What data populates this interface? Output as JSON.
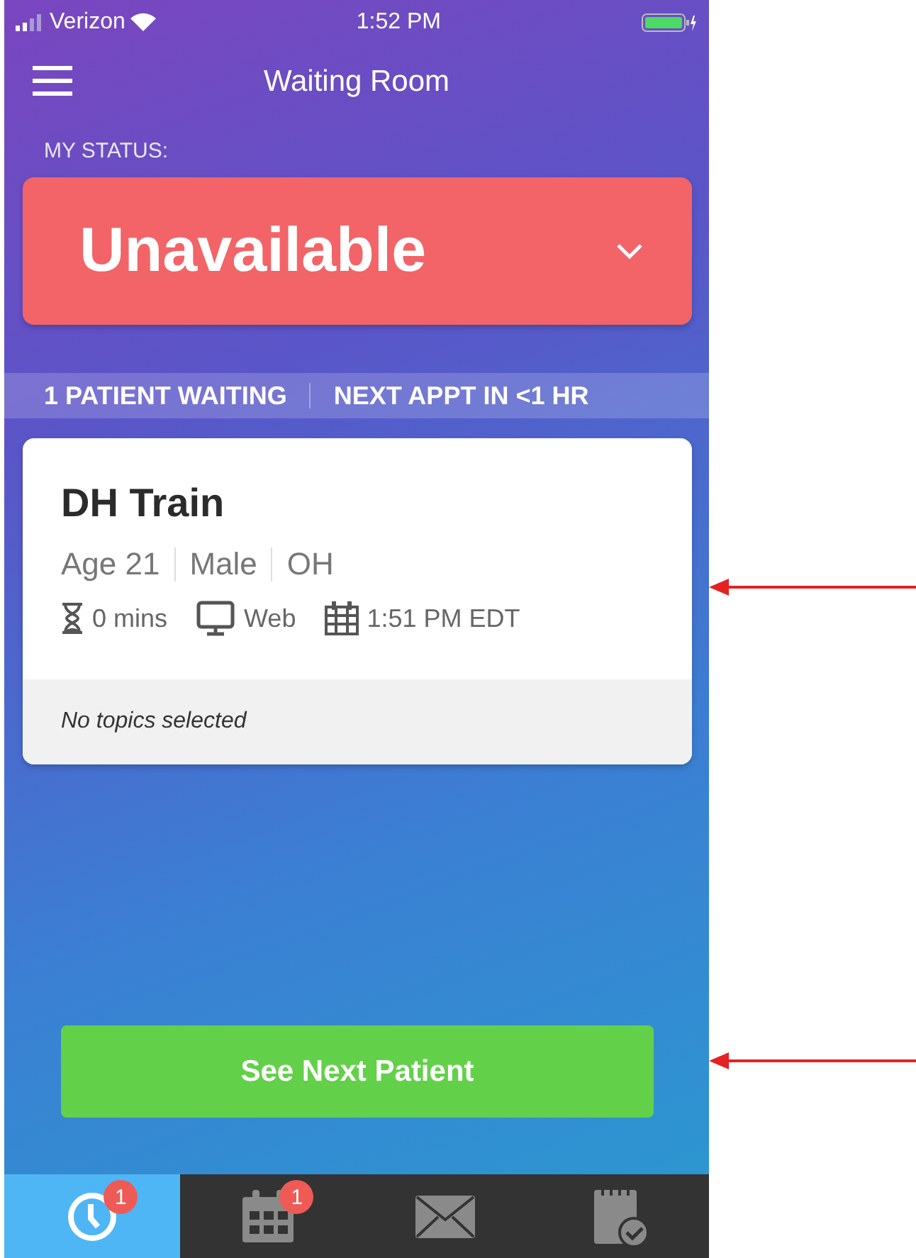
{
  "status_bar": {
    "carrier": "Verizon",
    "time": "1:52 PM"
  },
  "header": {
    "title": "Waiting Room"
  },
  "status": {
    "label": "MY STATUS:",
    "value": "Unavailable"
  },
  "summary": [
    "1 PATIENT WAITING",
    "NEXT APPT IN <1 HR"
  ],
  "patient_card": {
    "name": "DH Train",
    "details": [
      "Age 21",
      "Male",
      "OH"
    ],
    "meta": [
      {
        "kind": "wait",
        "text": "0 mins"
      },
      {
        "kind": "device",
        "text": "Web"
      },
      {
        "kind": "time",
        "text": "1:51 PM EDT"
      }
    ],
    "topics": "No topics selected"
  },
  "primary_button": "See Next Patient",
  "tabs": [
    {
      "kind": "clock",
      "selected": true,
      "badge": "1"
    },
    {
      "kind": "calendar",
      "selected": false,
      "badge": "1"
    },
    {
      "kind": "mail",
      "selected": false
    },
    {
      "kind": "notes",
      "selected": false
    }
  ],
  "annotations": [
    {
      "kind": "arrow"
    },
    {
      "kind": "arrow"
    }
  ]
}
